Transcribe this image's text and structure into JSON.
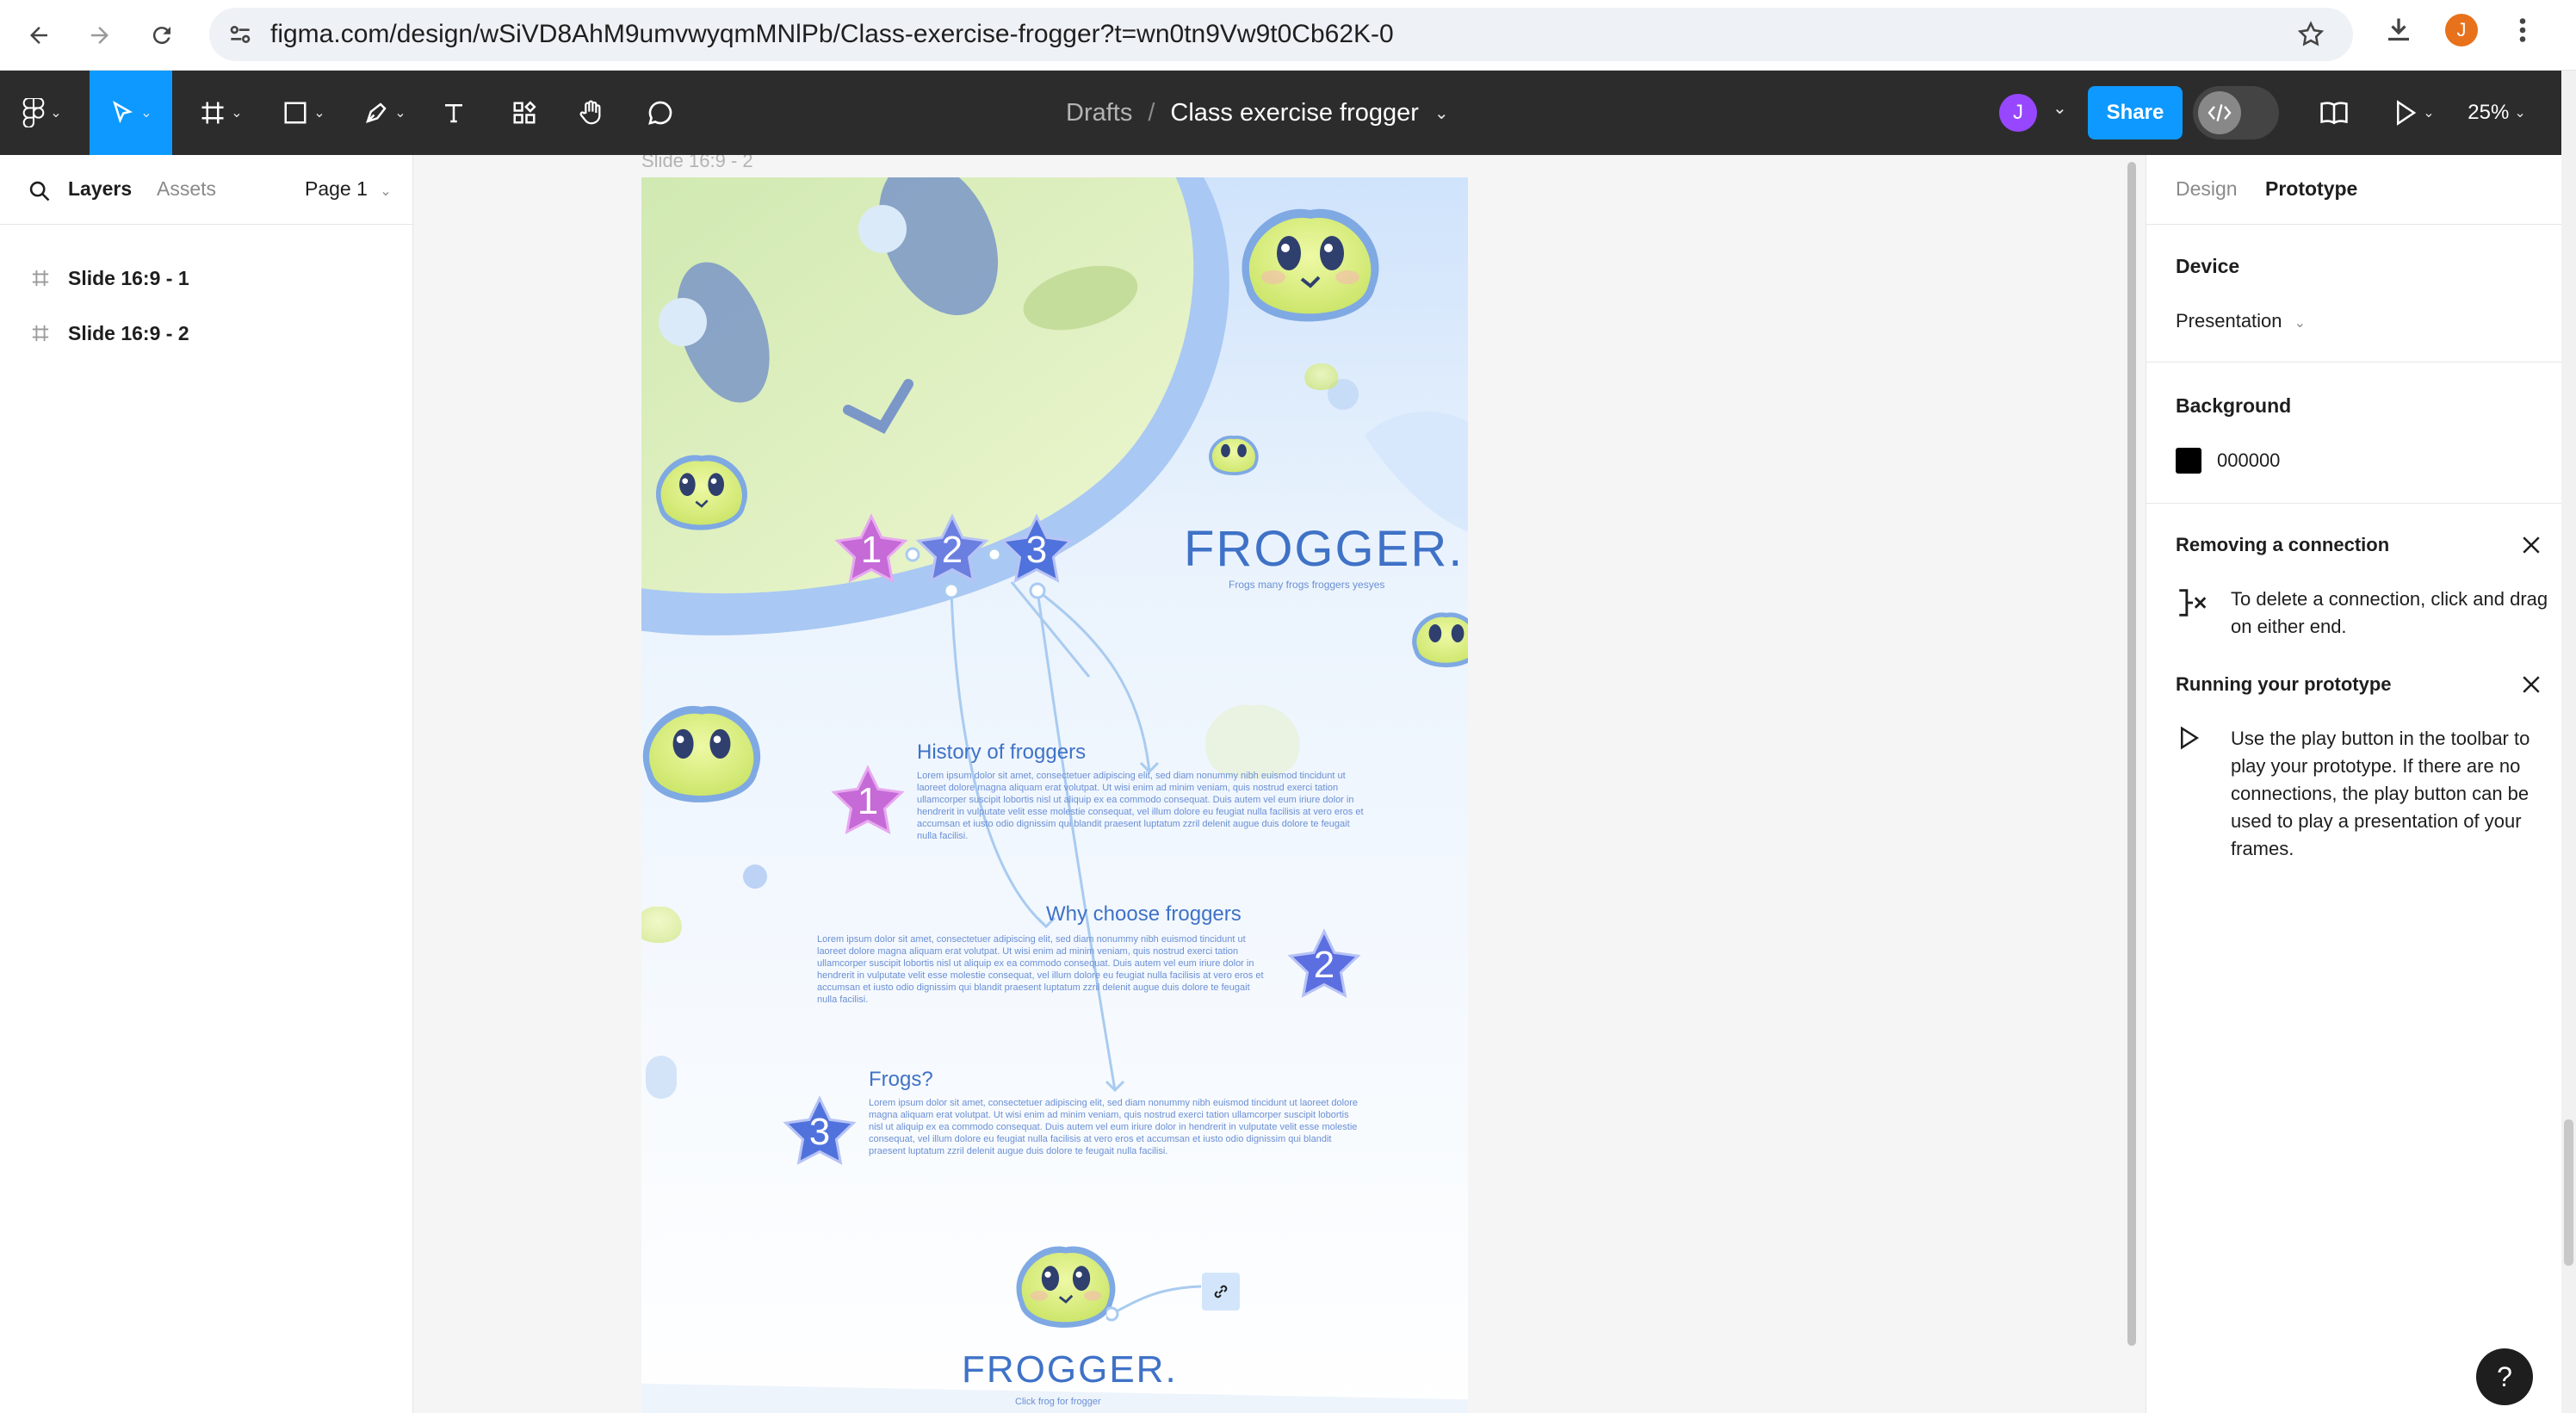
{
  "browser": {
    "url": "figma.com/design/wSiVD8AhM9umvwyqmMNlPb/Class-exercise-frogger?t=wn0tn9Vw9t0Cb62K-0",
    "profile_initial": "J"
  },
  "toolbar": {
    "breadcrumb_parent": "Drafts",
    "breadcrumb_sep": "/",
    "file_name": "Class exercise frogger",
    "user_initial": "J",
    "share_label": "Share",
    "zoom": "25%"
  },
  "left_panel": {
    "tabs": [
      "Layers",
      "Assets"
    ],
    "page_selector": "Page 1",
    "layers": [
      {
        "label": "Slide 16:9 - 1"
      },
      {
        "label": "Slide 16:9 - 2"
      }
    ]
  },
  "canvas": {
    "frame_label": "Slide 16:9 - 2",
    "slide": {
      "title": "FROGGER.",
      "subtitle": "Frogs many frogs froggers yesyes",
      "star_numbers": [
        "1",
        "2",
        "3"
      ],
      "sections": [
        {
          "number": "1",
          "heading": "History of froggers"
        },
        {
          "number": "2",
          "heading": "Why choose froggers"
        },
        {
          "number": "3",
          "heading": "Frogs?"
        }
      ],
      "lorem": "Lorem ipsum dolor sit amet, consectetuer adipiscing elit, sed diam nonummy nibh euismod tincidunt ut laoreet dolore magna aliquam erat volutpat. Ut wisi enim ad minim veniam, quis nostrud exerci tation ullamcorper suscipit lobortis nisl ut aliquip ex ea commodo consequat. Duis autem vel eum iriure dolor in hendrerit in vulputate velit esse molestie consequat, vel illum dolore eu feugiat nulla facilisis at vero eros et accumsan et iusto odio dignissim qui blandit praesent luptatum zzril delenit augue duis dolore te feugait nulla facilisi.",
      "footer_title": "FROGGER.",
      "footer_subtitle": "Click frog for frogger"
    }
  },
  "right_panel": {
    "tabs": [
      "Design",
      "Prototype"
    ],
    "device_label": "Device",
    "device_value": "Presentation",
    "background_label": "Background",
    "background_value": "000000",
    "background_color": "#000000",
    "tip1_title": "Removing a connection",
    "tip1_text": "To delete a connection, click and drag on either end.",
    "tip2_title": "Running your prototype",
    "tip2_text": "Use the play button in the toolbar to play your prototype. If there are no connections, the play button can be used to play a presentation of your frames."
  },
  "help": "?",
  "colors": {
    "accent": "#0d99ff",
    "toolbar_bg": "#2c2c2c",
    "frog_green": "#d7ef86",
    "slide_blue": "#3f72c7"
  }
}
